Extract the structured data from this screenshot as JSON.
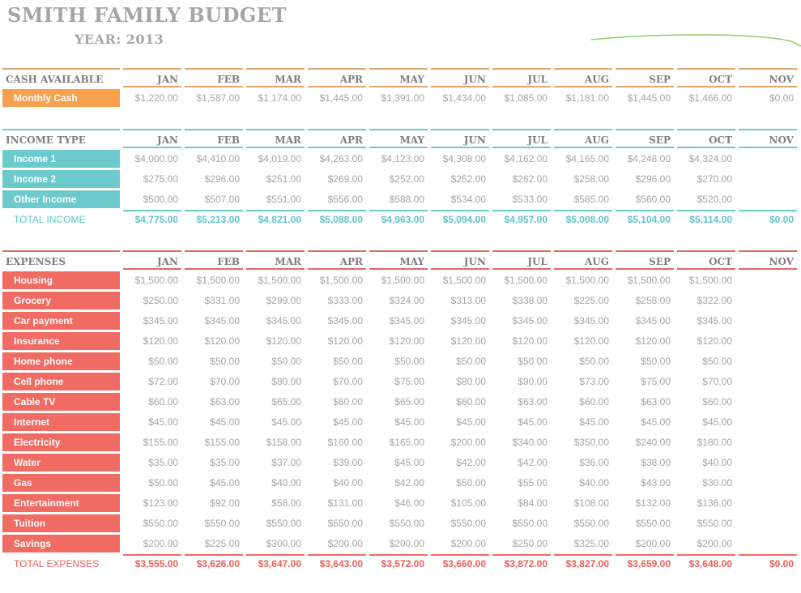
{
  "header": {
    "title": "SMITH FAMILY BUDGET",
    "year_label": "YEAR:",
    "year_value": "2013"
  },
  "months": [
    "JAN",
    "FEB",
    "MAR",
    "APR",
    "MAY",
    "JUN",
    "JUL",
    "AUG",
    "SEP",
    "OCT",
    "NOV"
  ],
  "colors": {
    "cash_accent": "#f7a04d",
    "income_accent": "#6cc9cc",
    "expenses_accent": "#f06b63",
    "header_text": "#7f7f7f",
    "value_text": "#a5a5a5",
    "swoosh": "#8dc663"
  },
  "cash": {
    "heading": "CASH AVAILABLE",
    "rows": [
      {
        "label": "Monthly Cash",
        "values": [
          "$1,220.00",
          "$1,587.00",
          "$1,174.00",
          "$1,445.00",
          "$1,391.00",
          "$1,434.00",
          "$1,085.00",
          "$1,181.00",
          "$1,445.00",
          "$1,466.00",
          "$0.00"
        ]
      }
    ]
  },
  "income": {
    "heading": "INCOME TYPE",
    "rows": [
      {
        "label": "Income 1",
        "values": [
          "$4,000.00",
          "$4,410.00",
          "$4,019.00",
          "$4,263.00",
          "$4,123.00",
          "$4,308.00",
          "$4,162.00",
          "$4,165.00",
          "$4,248.00",
          "$4,324.00",
          ""
        ]
      },
      {
        "label": "Income 2",
        "values": [
          "$275.00",
          "$296.00",
          "$251.00",
          "$269.00",
          "$252.00",
          "$252.00",
          "$262.00",
          "$258.00",
          "$296.00",
          "$270.00",
          ""
        ]
      },
      {
        "label": "Other Income",
        "values": [
          "$500.00",
          "$507.00",
          "$551.00",
          "$556.00",
          "$588.00",
          "$534.00",
          "$533.00",
          "$585.00",
          "$560.00",
          "$520.00",
          ""
        ]
      }
    ],
    "total": {
      "label": "TOTAL INCOME",
      "values": [
        "$4,775.00",
        "$5,213.00",
        "$4,821.00",
        "$5,088.00",
        "$4,963.00",
        "$5,094.00",
        "$4,957.00",
        "$5,008.00",
        "$5,104.00",
        "$5,114.00",
        "$0.00"
      ]
    }
  },
  "expenses": {
    "heading": "EXPENSES",
    "rows": [
      {
        "label": "Housing",
        "values": [
          "$1,500.00",
          "$1,500.00",
          "$1,500.00",
          "$1,500.00",
          "$1,500.00",
          "$1,500.00",
          "$1,500.00",
          "$1,500.00",
          "$1,500.00",
          "$1,500.00",
          ""
        ]
      },
      {
        "label": "Grocery",
        "values": [
          "$250.00",
          "$331.00",
          "$299.00",
          "$333.00",
          "$324.00",
          "$313.00",
          "$338.00",
          "$225.00",
          "$258.00",
          "$322.00",
          ""
        ]
      },
      {
        "label": "Car payment",
        "values": [
          "$345.00",
          "$345.00",
          "$345.00",
          "$345.00",
          "$345.00",
          "$345.00",
          "$345.00",
          "$345.00",
          "$345.00",
          "$345.00",
          ""
        ]
      },
      {
        "label": "Insurance",
        "values": [
          "$120.00",
          "$120.00",
          "$120.00",
          "$120.00",
          "$120.00",
          "$120.00",
          "$120.00",
          "$120.00",
          "$120.00",
          "$120.00",
          ""
        ]
      },
      {
        "label": "Home phone",
        "values": [
          "$50.00",
          "$50.00",
          "$50.00",
          "$50.00",
          "$50.00",
          "$50.00",
          "$50.00",
          "$50.00",
          "$50.00",
          "$50.00",
          ""
        ]
      },
      {
        "label": "Cell phone",
        "values": [
          "$72.00",
          "$70.00",
          "$80.00",
          "$70.00",
          "$75.00",
          "$80.00",
          "$90.00",
          "$73.00",
          "$75.00",
          "$70.00",
          ""
        ]
      },
      {
        "label": "Cable TV",
        "values": [
          "$60.00",
          "$63.00",
          "$65.00",
          "$60.00",
          "$65.00",
          "$60.00",
          "$63.00",
          "$60.00",
          "$63.00",
          "$60.00",
          ""
        ]
      },
      {
        "label": "Internet",
        "values": [
          "$45.00",
          "$45.00",
          "$45.00",
          "$45.00",
          "$45.00",
          "$45.00",
          "$45.00",
          "$45.00",
          "$45.00",
          "$45.00",
          ""
        ]
      },
      {
        "label": "Electricity",
        "values": [
          "$155.00",
          "$155.00",
          "$158.00",
          "$160.00",
          "$165.00",
          "$200.00",
          "$340.00",
          "$350.00",
          "$240.00",
          "$180.00",
          ""
        ]
      },
      {
        "label": "Water",
        "values": [
          "$35.00",
          "$35.00",
          "$37.00",
          "$39.00",
          "$45.00",
          "$42.00",
          "$42.00",
          "$36.00",
          "$38.00",
          "$40.00",
          ""
        ]
      },
      {
        "label": "Gas",
        "values": [
          "$50.00",
          "$45.00",
          "$40.00",
          "$40.00",
          "$42.00",
          "$50.00",
          "$55.00",
          "$40.00",
          "$43.00",
          "$30.00",
          ""
        ]
      },
      {
        "label": "Entertainment",
        "values": [
          "$123.00",
          "$92.00",
          "$58.00",
          "$131.00",
          "$46.00",
          "$105.00",
          "$84.00",
          "$108.00",
          "$132.00",
          "$136.00",
          ""
        ]
      },
      {
        "label": "Tuition",
        "values": [
          "$550.00",
          "$550.00",
          "$550.00",
          "$550.00",
          "$550.00",
          "$550.00",
          "$550.00",
          "$550.00",
          "$550.00",
          "$550.00",
          ""
        ]
      },
      {
        "label": "Savings",
        "values": [
          "$200.00",
          "$225.00",
          "$300.00",
          "$200.00",
          "$200.00",
          "$200.00",
          "$250.00",
          "$325.00",
          "$200.00",
          "$200.00",
          ""
        ]
      }
    ],
    "total": {
      "label": "TOTAL EXPENSES",
      "values": [
        "$3,555.00",
        "$3,626.00",
        "$3,647.00",
        "$3,643.00",
        "$3,572.00",
        "$3,660.00",
        "$3,872.00",
        "$3,827.00",
        "$3,659.00",
        "$3,648.00",
        "$0.00"
      ]
    }
  }
}
